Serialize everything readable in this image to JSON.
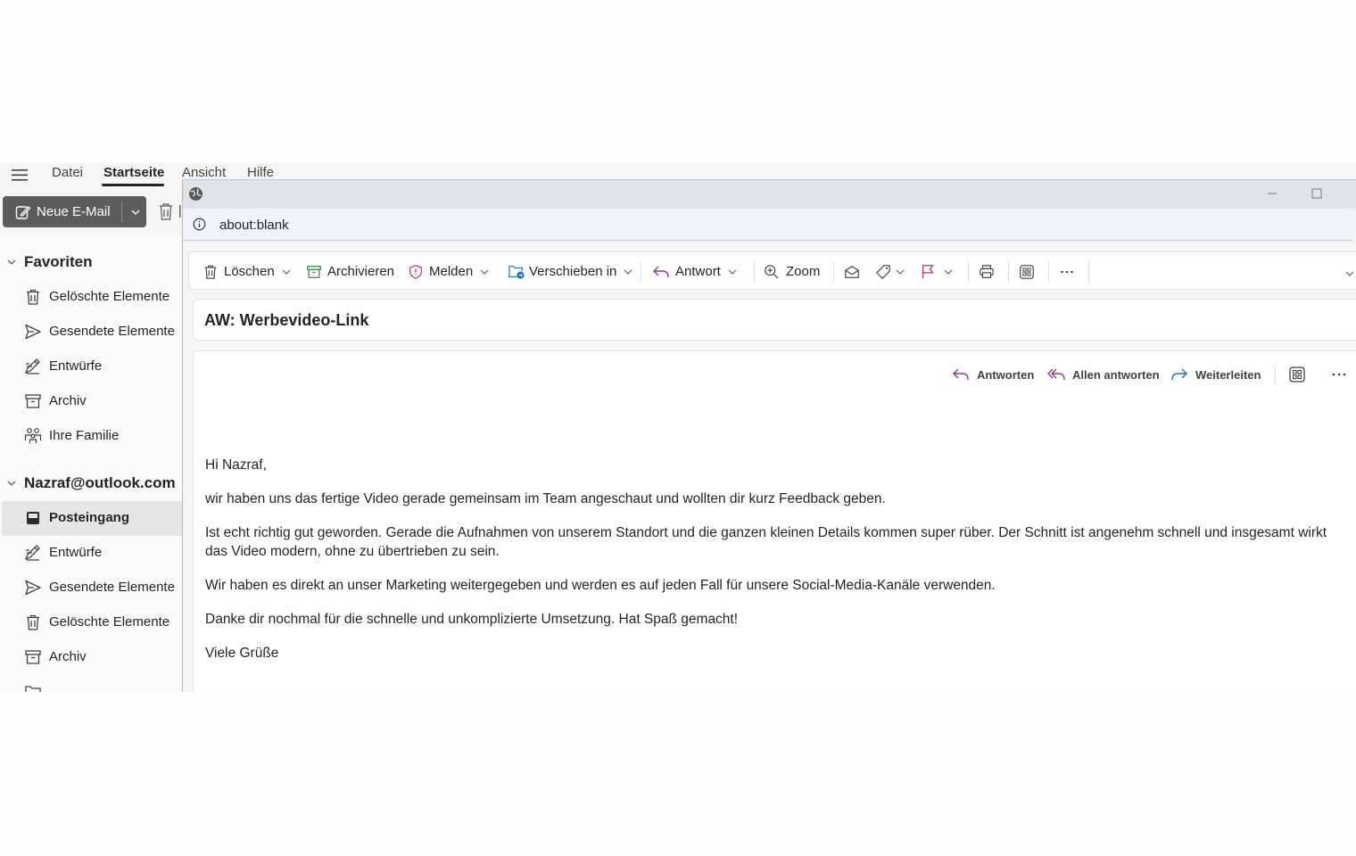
{
  "outlook": {
    "menu": {
      "file": "Datei",
      "home": "Startseite",
      "view": "Ansicht",
      "help": "Hilfe"
    },
    "new_mail": "Neue E-Mail",
    "favorites": {
      "title": "Favoriten",
      "items": [
        "Gelöschte Elemente",
        "Gesendete Elemente",
        "Entwürfe",
        "Archiv",
        "Ihre Familie"
      ]
    },
    "account": {
      "title": "Nazraf@outlook.com",
      "items": [
        "Posteingang",
        "Entwürfe",
        "Gesendete Elemente",
        "Gelöschte Elemente",
        "Archiv"
      ]
    }
  },
  "popup": {
    "url": "about:blank",
    "toolbar": {
      "delete": "Löschen",
      "archive": "Archivieren",
      "report": "Melden",
      "move": "Verschieben in",
      "reply": "Antwort",
      "zoom": "Zoom"
    },
    "subject": "AW: Werbevideo-Link",
    "actions": {
      "reply": "Antworten",
      "reply_all": "Allen antworten",
      "forward": "Weiterleiten"
    },
    "body": {
      "greeting": "Hi Nazraf,",
      "p1": "wir haben uns das fertige Video gerade gemeinsam im Team angeschaut und wollten dir kurz Feedback geben.",
      "p2": "Ist echt richtig gut geworden. Gerade die Aufnahmen von unserem Standort und die ganzen kleinen Details kommen super rüber. Der Schnitt ist angenehm schnell und insgesamt wirkt das Video modern, ohne zu übertrieben zu sein.",
      "p3": "Wir haben es direkt an unser Marketing weitergegeben und werden es auf jeden Fall für unsere Social-Media-Kanäle verwenden.",
      "p4": "Danke dir nochmal für die schnelle und unkomplizierte Umsetzung. Hat Spaß gemacht!",
      "closing": "Viele Grüße"
    }
  },
  "colors": {
    "accent_purple": "#8a3d8f",
    "flag_red": "#c4314b",
    "new_mail_bg": "#5c5c5c",
    "selected_bg": "#e5e5e5"
  }
}
